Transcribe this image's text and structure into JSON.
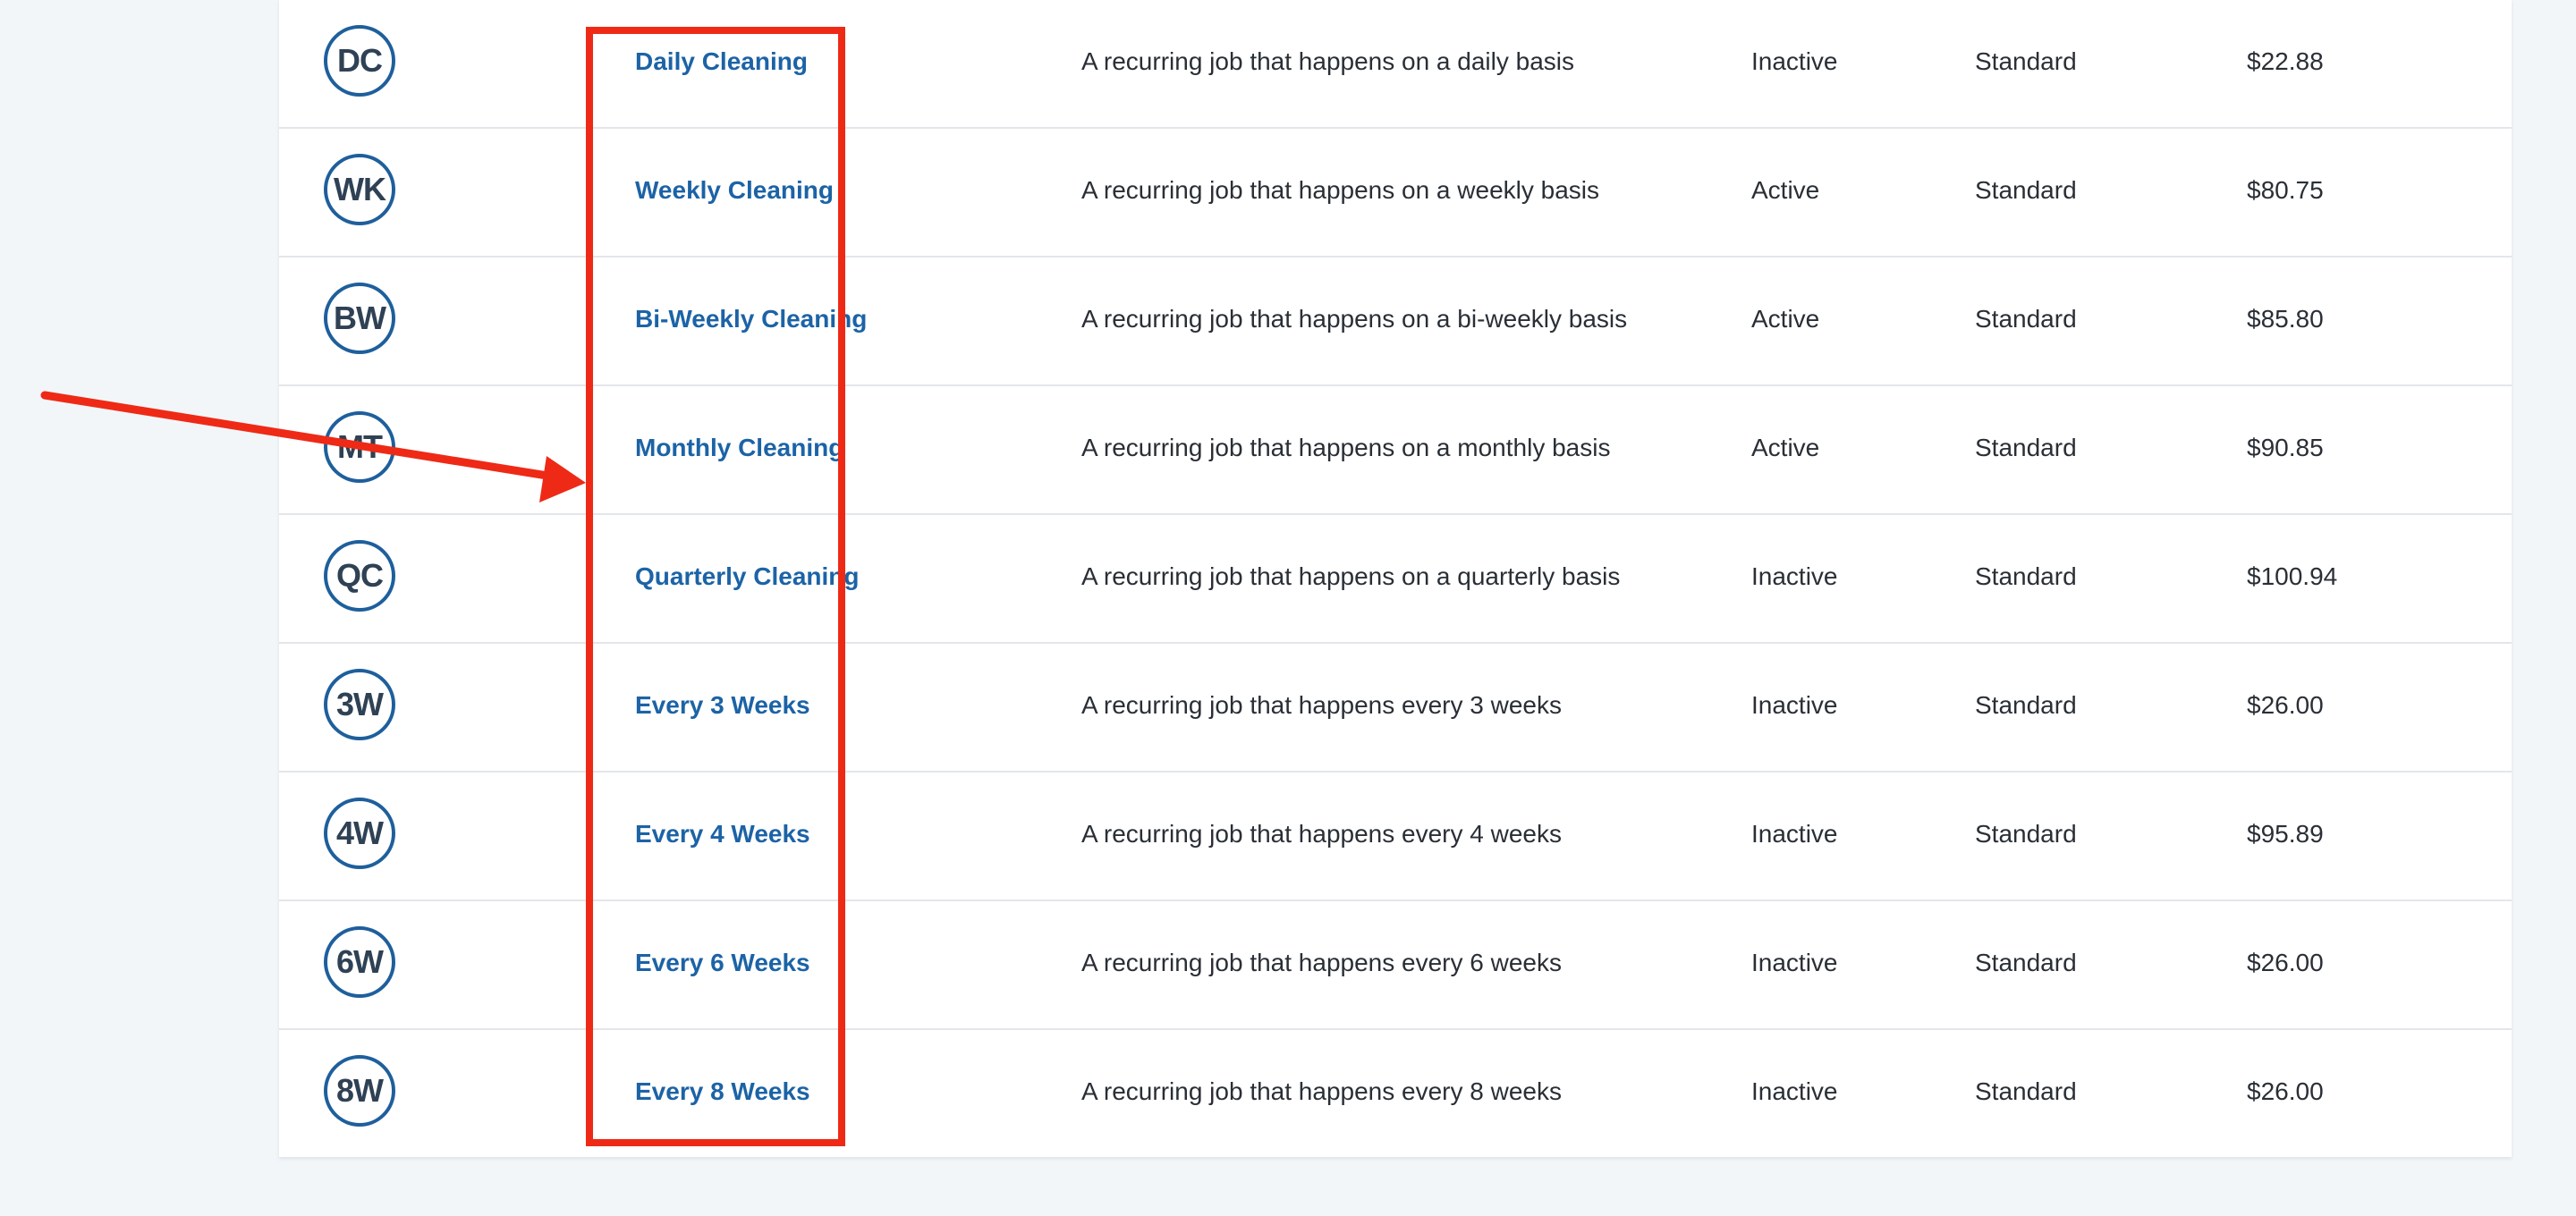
{
  "colors": {
    "link": "#1c63a6",
    "avatar_border": "#1e5f9c",
    "annotation": "#ee2a16",
    "page_background": "#f2f6f9"
  },
  "table": {
    "rows": [
      {
        "initials": "DC",
        "name": "Daily Cleaning",
        "description": "A recurring job that happens on a daily basis",
        "status": "Inactive",
        "type": "Standard",
        "price": "$22.88"
      },
      {
        "initials": "WK",
        "name": "Weekly Cleaning",
        "description": "A recurring job that happens on a weekly basis",
        "status": "Active",
        "type": "Standard",
        "price": "$80.75"
      },
      {
        "initials": "BW",
        "name": "Bi-Weekly Cleaning",
        "description": "A recurring job that happens on a bi-weekly basis",
        "status": "Active",
        "type": "Standard",
        "price": "$85.80"
      },
      {
        "initials": "MT",
        "name": "Monthly Cleaning",
        "description": "A recurring job that happens on a monthly basis",
        "status": "Active",
        "type": "Standard",
        "price": "$90.85"
      },
      {
        "initials": "QC",
        "name": "Quarterly Cleaning",
        "description": "A recurring job that happens on a quarterly basis",
        "status": "Inactive",
        "type": "Standard",
        "price": "$100.94"
      },
      {
        "initials": "3W",
        "name": "Every 3 Weeks",
        "description": "A recurring job that happens every 3 weeks",
        "status": "Inactive",
        "type": "Standard",
        "price": "$26.00"
      },
      {
        "initials": "4W",
        "name": "Every 4 Weeks",
        "description": "A recurring job that happens every 4 weeks",
        "status": "Inactive",
        "type": "Standard",
        "price": "$95.89"
      },
      {
        "initials": "6W",
        "name": "Every 6 Weeks",
        "description": "A recurring job that happens every 6 weeks",
        "status": "Inactive",
        "type": "Standard",
        "price": "$26.00"
      },
      {
        "initials": "8W",
        "name": "Every 8 Weeks",
        "description": "A recurring job that happens every 8 weeks",
        "status": "Inactive",
        "type": "Standard",
        "price": "$26.00"
      }
    ]
  }
}
